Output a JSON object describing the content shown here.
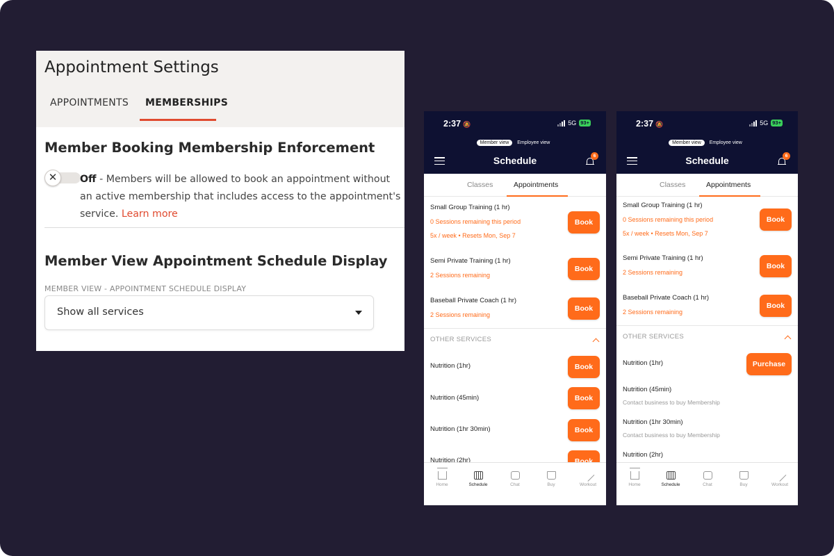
{
  "settings": {
    "title": "Appointment Settings",
    "tabs": [
      "APPOINTMENTS",
      "MEMBERSHIPS"
    ],
    "enforcement_heading": "Member Booking Membership Enforcement",
    "toggle_state": "Off",
    "toggle_text": " - Members will be allowed to book an appointment without an active membership that includes access to the appointment's service.",
    "learn_more": "Learn more",
    "display_heading": "Member View Appointment Schedule Display",
    "field_label": "MEMBER VIEW - APPOINTMENT SCHEDULE DISPLAY",
    "select_value": "Show all services"
  },
  "phone_common": {
    "time": "2:37",
    "network": "5G",
    "battery": "93+",
    "view_member": "Member view",
    "view_employee": "Employee view",
    "nav_title": "Schedule",
    "notif_count": "6",
    "tab_classes": "Classes",
    "tab_appointments": "Appointments",
    "book": "Book",
    "purchase": "Purchase",
    "other_services": "OTHER SERVICES",
    "bottom_tabs": [
      "Home",
      "Schedule",
      "Chat",
      "Buy",
      "Workout"
    ]
  },
  "phone1": {
    "services": [
      {
        "name": "Small Group Training (1 hr)",
        "line1": "0 Sessions remaining this period",
        "line2": "5x / week  •  Resets Mon, Sep 7"
      },
      {
        "name": "Semi Private Training (1 hr)",
        "line1": "2 Sessions remaining"
      },
      {
        "name": "Baseball Private Coach (1 hr)",
        "line1": "2 Sessions remaining"
      }
    ],
    "other": [
      {
        "name": "Nutrition (1hr)"
      },
      {
        "name": "Nutrition (45min)"
      },
      {
        "name": "Nutrition (1hr 30min)"
      },
      {
        "name": "Nutrition (2hr)"
      }
    ]
  },
  "phone2": {
    "services": [
      {
        "name": "Small Group Training (1 hr)",
        "line1": "0 Sessions remaining this period",
        "line2": "5x / week  •  Resets Mon, Sep 7"
      },
      {
        "name": "Semi Private Training (1 hr)",
        "line1": "2 Sessions remaining"
      },
      {
        "name": "Baseball Private Coach (1 hr)",
        "line1": "2 Sessions remaining"
      }
    ],
    "other": [
      {
        "name": "Nutrition (1hr)"
      },
      {
        "name": "Nutrition (45min)",
        "note": "Contact business to buy Membership"
      },
      {
        "name": "Nutrition (1hr 30min)",
        "note": "Contact business to buy Membership"
      },
      {
        "name": "Nutrition (2hr)"
      }
    ]
  },
  "colors": {
    "background": "#221d33",
    "accent_orange": "#ff6b1a",
    "tab_underline_red": "#e04a2f",
    "phone_nav": "#0e1132"
  }
}
